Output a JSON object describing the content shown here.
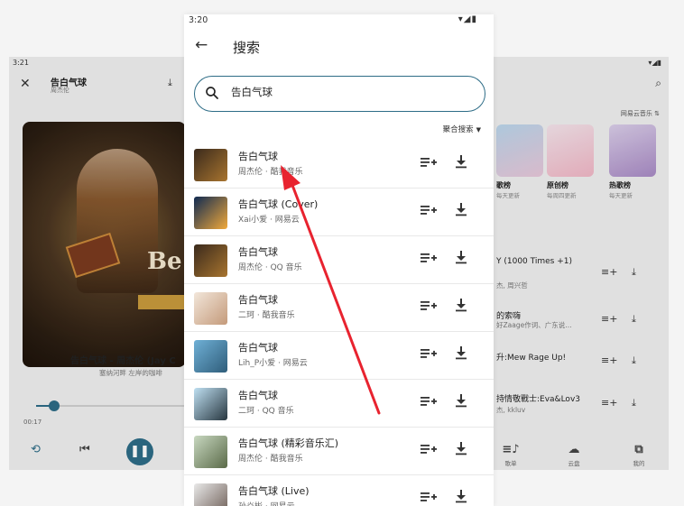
{
  "left_screen": {
    "status_time": "3:21",
    "title": "告白气球",
    "artist": "周杰伦",
    "song_line": "告白气球 - 周杰伦 (Jay C",
    "sub_line": "塞纳河畔 左岸的咖啡",
    "time": "00:17",
    "cover_text": "Be"
  },
  "right_screen": {
    "source_label": "网易云音乐 ⇅",
    "cards": [
      {
        "label": "歌榜",
        "sub": "每天更新",
        "colors": [
          "#b9d5ea",
          "#e7c6d8"
        ]
      },
      {
        "label": "原创榜",
        "sub": "每周四更新",
        "colors": [
          "#f3e3ea",
          "#f0b6c5"
        ]
      },
      {
        "label": "热歌榜",
        "sub": "每天更新",
        "colors": [
          "#d9cde8",
          "#a88ac4"
        ]
      }
    ],
    "rows": [
      {
        "title": "Y (1000 Times +1)",
        "sub": "杰, 周兴哲"
      },
      {
        "title": "的索嗨",
        "sub": "好Zaage作词、广东说…"
      },
      {
        "title": "升:Mew Rage Up!",
        "sub": ""
      },
      {
        "title": "持情敬戰士:Eva&Lov3",
        "sub": "杰, kkluv"
      }
    ],
    "nav": [
      {
        "icon": "≡♪",
        "label": "歌单"
      },
      {
        "icon": "☁",
        "label": "云盘"
      },
      {
        "icon": "⧉",
        "label": "我的"
      }
    ]
  },
  "main": {
    "status_time": "3:20",
    "status_icons": "▾◢▮",
    "title": "搜索",
    "search_value": "告白气球",
    "filter_label": "聚合搜索",
    "accent": "#2d6c86",
    "results": [
      {
        "title": "告白气球",
        "sub": "周杰伦 · 酷我音乐",
        "thumb": [
          "#3a2a1c",
          "#a8742f"
        ]
      },
      {
        "title": "告白气球 (Cover)",
        "sub": "Xai小爱 · 网易云",
        "thumb": [
          "#0f2a52",
          "#f1a93a"
        ]
      },
      {
        "title": "告白气球",
        "sub": "周杰伦 · QQ 音乐",
        "thumb": [
          "#3a2a1c",
          "#a8742f"
        ]
      },
      {
        "title": "告白气球",
        "sub": "二珂 · 酷我音乐",
        "thumb": [
          "#f2e6da",
          "#c49a7a"
        ]
      },
      {
        "title": "告白气球",
        "sub": "Lih_P小爱 · 网易云",
        "thumb": [
          "#6fb0d6",
          "#2f5d7a"
        ]
      },
      {
        "title": "告白气球",
        "sub": "二珂 · QQ 音乐",
        "thumb": [
          "#bfe0f2",
          "#27363f"
        ]
      },
      {
        "title": "告白气球 (精彩音乐汇)",
        "sub": "周杰伦 · 酷我音乐",
        "thumb": [
          "#c8d8c0",
          "#5a6a48"
        ]
      },
      {
        "title": "告白气球 (Live)",
        "sub": "孙焱彬 · 网易云",
        "thumb": [
          "#e9e9e9",
          "#6a5a52"
        ]
      }
    ]
  }
}
